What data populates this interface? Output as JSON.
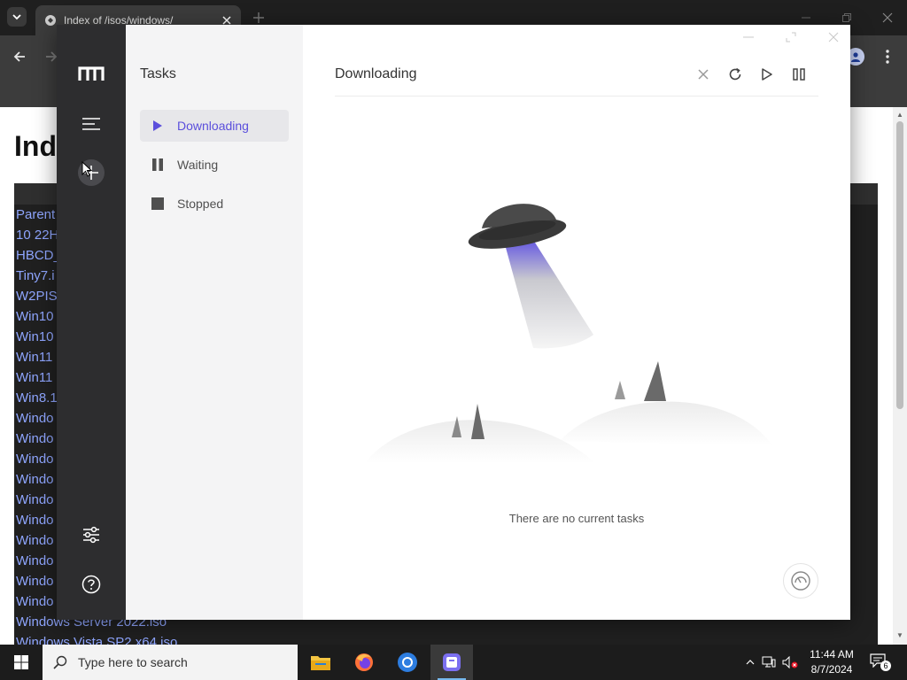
{
  "browser": {
    "tab_title": "Index of /isos/windows/",
    "page_heading": "Ind",
    "listing": [
      "Parent",
      "10 22H",
      "HBCD_",
      "Tiny7.i",
      "W2PIS",
      "Win10",
      "Win10",
      "Win11",
      "Win11",
      "Win8.1",
      "Windo",
      "Windo",
      "Windo",
      "Windo",
      "Windo",
      "Windo",
      "Windo",
      "Windo",
      "Windo",
      "Windo",
      "Windows Server 2022.iso",
      "Windows Vista SP2 x64.iso"
    ]
  },
  "app": {
    "subnav": {
      "title": "Tasks",
      "items": [
        {
          "label": "Downloading",
          "icon": "play-icon",
          "active": true
        },
        {
          "label": "Waiting",
          "icon": "pause-icon",
          "active": false
        },
        {
          "label": "Stopped",
          "icon": "stop-icon",
          "active": false
        }
      ]
    },
    "main": {
      "title": "Downloading",
      "empty_text": "There are no current tasks"
    },
    "colors": {
      "accent": "#5b4fdc",
      "rail": "#2d2d2f",
      "subnav": "#f4f4f5"
    }
  },
  "taskbar": {
    "search_placeholder": "Type here to search",
    "time": "11:44 AM",
    "date": "8/7/2024",
    "notification_count": "6"
  }
}
